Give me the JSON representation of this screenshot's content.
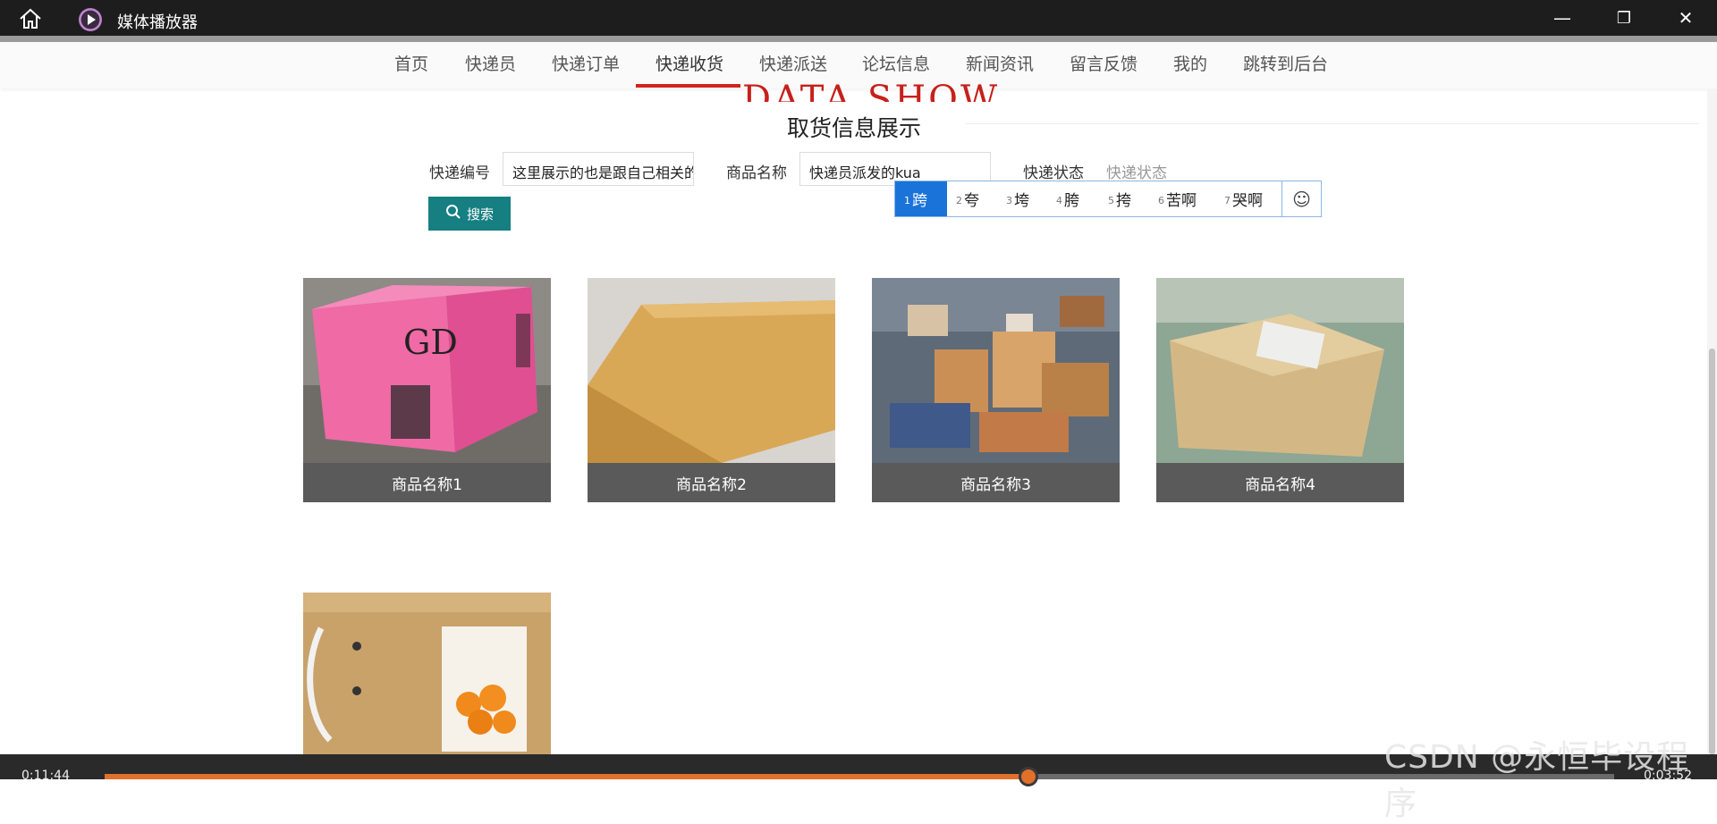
{
  "window": {
    "title": "媒体播放器",
    "controls": {
      "minimize": "—",
      "maximize": "❐",
      "close": "✕"
    }
  },
  "nav": {
    "items": [
      "首页",
      "快递员",
      "快递订单",
      "快递收货",
      "快递派送",
      "论坛信息",
      "新闻资讯",
      "留言反馈",
      "我的",
      "跳转到后台"
    ],
    "active_index": 3
  },
  "page": {
    "banner": "DATA SHOW",
    "section_title": "取货信息展示"
  },
  "search": {
    "tracking_label": "快递编号",
    "tracking_value": "这里展示的也是跟自己相关的",
    "product_label": "商品名称",
    "product_value": "快递员派发的kua",
    "status_label": "快递状态",
    "status_placeholder": "快递状态",
    "button_label": "搜索"
  },
  "ime": {
    "candidates": [
      {
        "n": "1",
        "text": "跨"
      },
      {
        "n": "2",
        "text": "夸"
      },
      {
        "n": "3",
        "text": "垮"
      },
      {
        "n": "4",
        "text": "胯"
      },
      {
        "n": "5",
        "text": "挎"
      },
      {
        "n": "6",
        "text": "苦啊"
      },
      {
        "n": "7",
        "text": "哭啊"
      }
    ],
    "selected_index": 0
  },
  "products": [
    {
      "name": "商品名称1",
      "image": "pink-box"
    },
    {
      "name": "商品名称2",
      "image": "flat-box"
    },
    {
      "name": "商品名称3",
      "image": "parcel-pile"
    },
    {
      "name": "商品名称4",
      "image": "taped-box"
    },
    {
      "name": "",
      "image": "orange-box"
    }
  ],
  "player": {
    "elapsed": "0:11:44",
    "total": "0:03:52",
    "progress": 0.612
  },
  "watermark": "CSDN @永恒毕设程序",
  "colors": {
    "accent_red": "#d0251c",
    "button_teal": "#167f82",
    "ime_selected": "#1a73d9",
    "progress": "#e0702a"
  }
}
